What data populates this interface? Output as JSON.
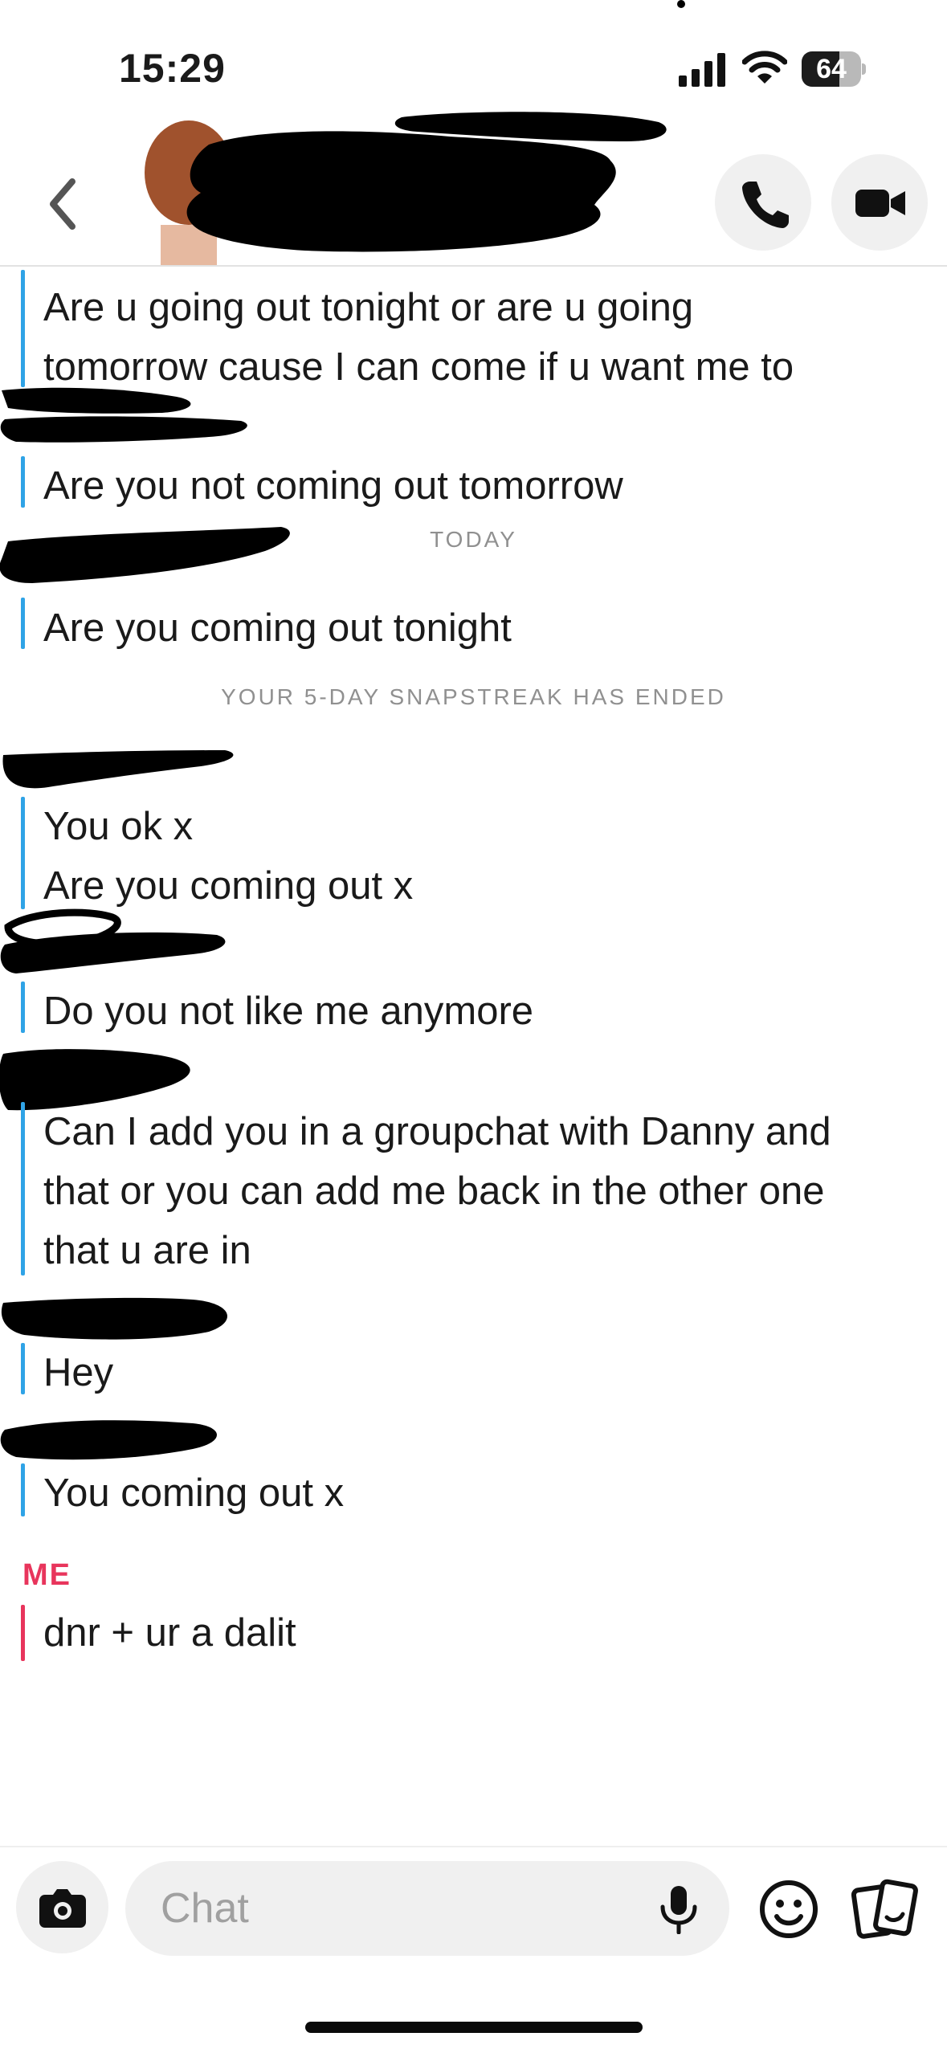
{
  "status_bar": {
    "time": "15:29",
    "battery_level": "64",
    "battery_fraction": 0.64
  },
  "header": {
    "contact_name": "",
    "redacted": true
  },
  "messages": [
    {
      "lines": [
        "Are u going out tonight or are u going",
        "tomorrow cause I can come if u want me to"
      ]
    },
    {
      "lines": [
        "Are you not coming out tomorrow"
      ]
    },
    {
      "lines": [
        "Are you coming out tonight"
      ]
    },
    {
      "lines": [
        "You ok x",
        "Are you coming out x"
      ]
    },
    {
      "lines": [
        "Do you not like me anymore"
      ]
    },
    {
      "lines": [
        "Can I add you in a groupchat with Danny and",
        "that or you can add me back in the other one",
        "that u are in"
      ]
    },
    {
      "lines": [
        "Hey"
      ]
    },
    {
      "lines": [
        "You coming out x"
      ]
    },
    {
      "lines": [
        "dnr + ur a dalit"
      ]
    }
  ],
  "system_notes": {
    "today": "TODAY",
    "streak_ended": "YOUR 5-DAY SNAPSTREAK HAS ENDED"
  },
  "me_label": "ME",
  "composer": {
    "placeholder": "Chat"
  },
  "colors": {
    "friend_accent": "#2fa3e6",
    "me_accent": "#e8355c",
    "system_text": "#909090"
  },
  "icons": [
    "back-chevron-icon",
    "phone-icon",
    "video-camera-icon",
    "camera-icon",
    "microphone-icon",
    "smiley-icon",
    "cards-icon"
  ]
}
